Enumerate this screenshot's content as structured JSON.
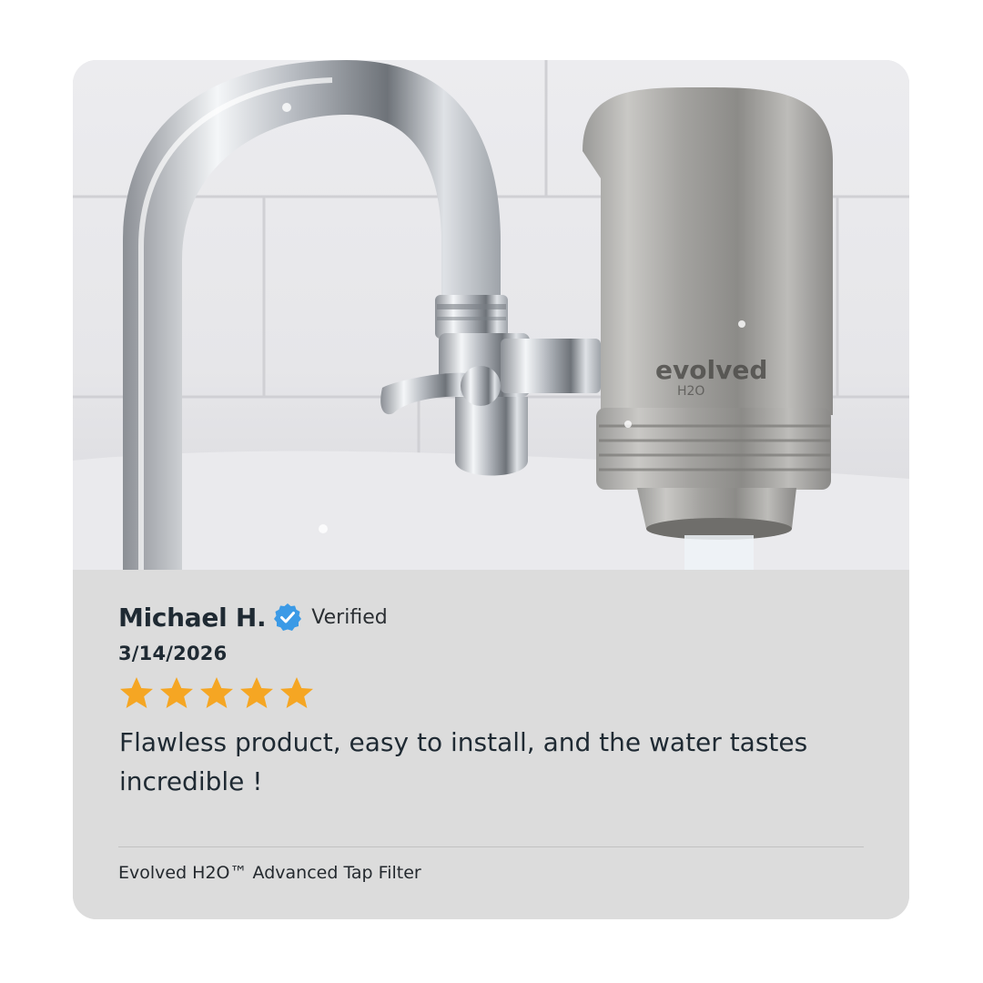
{
  "review": {
    "reviewer_name": "Michael H.",
    "verified_label": "Verified",
    "date": "3/14/2026",
    "rating": 5,
    "max_rating": 5,
    "text": "Flawless product, easy to install, and the water tastes incredible !",
    "product_name": "Evolved H2O™ Advanced Tap Filter"
  },
  "photo": {
    "brand_text": "evolved",
    "brand_sub": "H2O"
  },
  "colors": {
    "card_background": "#dcdcdc",
    "star": "#f5a623",
    "verified_badge": "#3b9ae6",
    "text": "#1f2a33"
  },
  "icons": {
    "verified": "verified-check-icon",
    "star": "star-icon"
  }
}
